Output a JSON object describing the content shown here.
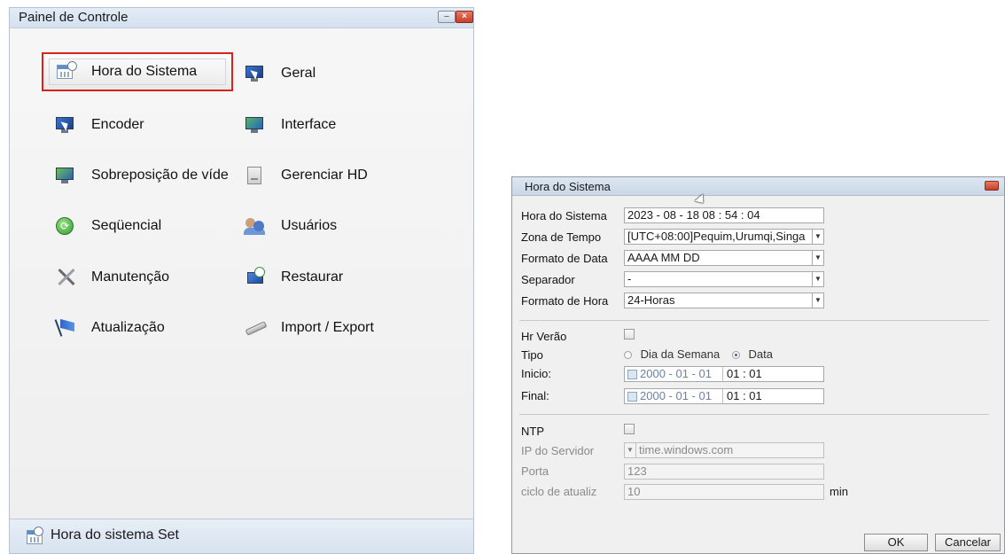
{
  "control_panel": {
    "title": "Painel de Controle",
    "items": [
      {
        "label": "Hora do Sistema",
        "icon": "system-time-icon"
      },
      {
        "label": "Geral",
        "icon": "general-icon"
      },
      {
        "label": "Encoder",
        "icon": "encoder-icon"
      },
      {
        "label": "Interface",
        "icon": "interface-icon"
      },
      {
        "label": "Sobreposição de víde",
        "icon": "video-overlay-icon"
      },
      {
        "label": "Gerenciar HD",
        "icon": "hard-disk-icon"
      },
      {
        "label": "Seqüencial",
        "icon": "sequential-icon"
      },
      {
        "label": "Usuários",
        "icon": "users-icon"
      },
      {
        "label": "Manutenção",
        "icon": "maintenance-icon"
      },
      {
        "label": "Restaurar",
        "icon": "restore-icon"
      },
      {
        "label": "Atualização",
        "icon": "update-icon"
      },
      {
        "label": "Import / Export",
        "icon": "import-export-icon"
      }
    ],
    "status": "Hora do sistema Set",
    "highlight_color": "#d8231c"
  },
  "dialog": {
    "title": "Hora do Sistema",
    "fields": {
      "system_time": {
        "label": "Hora do Sistema",
        "value": "2023 - 08 - 18  08 : 54 : 04"
      },
      "time_zone": {
        "label": "Zona de Tempo",
        "value": "[UTC+08:00]Pequim,Urumqi,Singa"
      },
      "date_format": {
        "label": "Formato de Data",
        "value": "AAAA MM DD"
      },
      "separator": {
        "label": "Separador",
        "value": "-"
      },
      "time_format": {
        "label": "Formato de Hora",
        "value": "24-Horas"
      },
      "dst": {
        "label": "Hr Verão"
      },
      "type": {
        "label": "Tipo",
        "option_weekday": "Dia da Semana",
        "option_date": "Data",
        "selected": "Data"
      },
      "start": {
        "label": "Inicio:",
        "date": "2000 - 01 - 01",
        "time": "01 : 01"
      },
      "end": {
        "label": "Final:",
        "date": "2000 - 01 - 01",
        "time": "01 : 01"
      },
      "ntp": {
        "label": "NTP"
      },
      "server_ip": {
        "label": "IP do Servidor",
        "value": "time.windows.com"
      },
      "port": {
        "label": "Porta",
        "value": "123"
      },
      "update_cycle": {
        "label": "ciclo de atualiz",
        "value": "10",
        "unit": "min"
      }
    },
    "buttons": {
      "ok": "OK",
      "cancel": "Cancelar"
    }
  }
}
